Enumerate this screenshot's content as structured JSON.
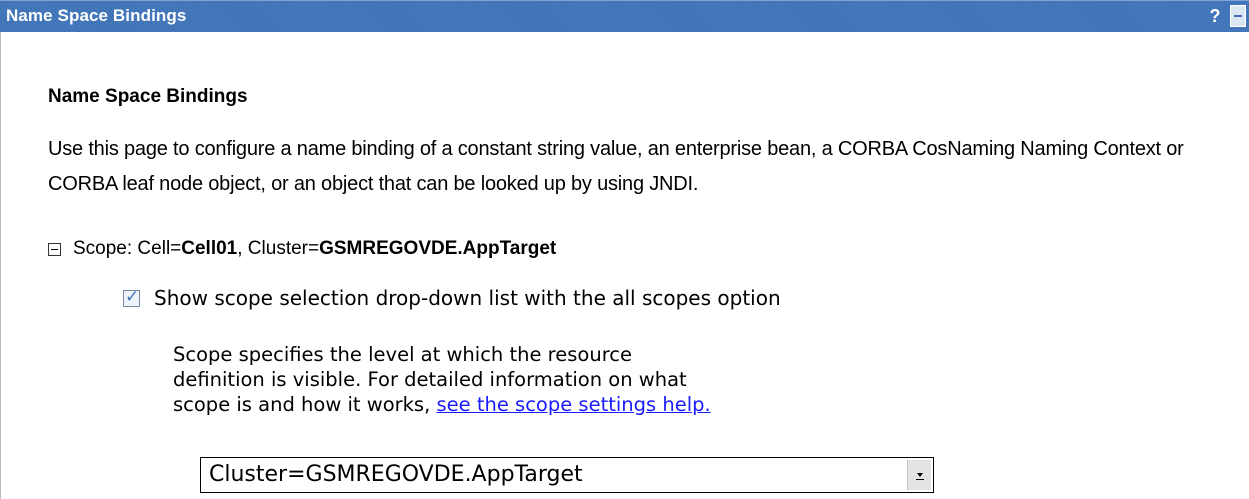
{
  "panel": {
    "title": "Name Space Bindings",
    "help_label": "?"
  },
  "page": {
    "heading": "Name Space Bindings",
    "description": "Use this page to configure a name binding of a constant string value, an enterprise bean, a CORBA CosNaming Naming Context or CORBA leaf node object, or an object that can be looked up by using JNDI."
  },
  "scope": {
    "prefix": "Scope: Cell=",
    "cell": "Cell01",
    "sep": ", Cluster=",
    "cluster": "GSMREGOVDE.AppTarget",
    "checkbox_label": "Show scope selection drop-down list with the all scopes option",
    "checkbox_checked": true,
    "help_text": "Scope specifies the level at which the resource definition is visible. For detailed information on what scope is and how it works, ",
    "help_link": "see the scope settings help.",
    "selected": "Cluster=GSMREGOVDE.AppTarget"
  },
  "icons": {
    "collapse": "collapse-icon",
    "minimize": "minimize-icon",
    "dropdown": "chevron-down-icon"
  },
  "colors": {
    "titlebar": "#3f73b8",
    "link": "#1a1aff"
  }
}
